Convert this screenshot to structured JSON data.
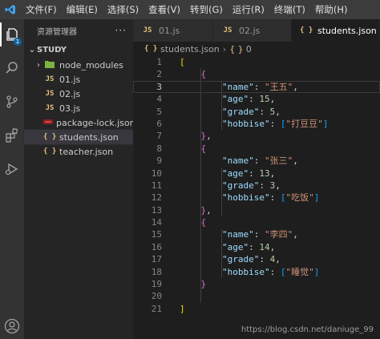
{
  "menu": [
    "文件(F)",
    "编辑(E)",
    "选择(S)",
    "查看(V)",
    "转到(G)",
    "运行(R)",
    "终端(T)",
    "帮助(H)"
  ],
  "activity": {
    "explorer_badge": "1"
  },
  "sidebar": {
    "title": "资源管理器",
    "more": "···",
    "folder": "STUDY",
    "items": [
      {
        "label": "node_modules",
        "icon": "node-folder-icon",
        "chevron": "›"
      },
      {
        "label": "01.js",
        "icon": "JS"
      },
      {
        "label": "02.js",
        "icon": "JS"
      },
      {
        "label": "03.js",
        "icon": "JS"
      },
      {
        "label": "package-lock.json",
        "icon": "lock-file-icon"
      },
      {
        "label": "students.json",
        "icon": "{ }"
      },
      {
        "label": "teacher.json",
        "icon": "{ }"
      }
    ]
  },
  "tabs": [
    {
      "label": "01.js",
      "icon": "JS"
    },
    {
      "label": "02.js",
      "icon": "JS"
    },
    {
      "label": "students.json",
      "icon": "{ }"
    }
  ],
  "breadcrumb": {
    "file_icon": "{ }",
    "file": "students.json",
    "separator": "›",
    "node_icon": "{ }",
    "node": "0"
  },
  "editor": {
    "line_numbers": [
      "1",
      "2",
      "3",
      "4",
      "5",
      "6",
      "7",
      "8",
      "9",
      "10",
      "11",
      "12",
      "13",
      "14",
      "15",
      "16",
      "17",
      "18",
      "19",
      "20",
      "21"
    ],
    "current_line": 3,
    "lines": [
      [
        {
          "t": "[",
          "c": "b1"
        }
      ],
      [
        {
          "t": "    ",
          "c": "p"
        },
        {
          "t": "{",
          "c": "b2"
        }
      ],
      [
        {
          "t": "        ",
          "c": "p"
        },
        {
          "t": "\"name\"",
          "c": "k"
        },
        {
          "t": ": ",
          "c": "p"
        },
        {
          "t": "\"王五\"",
          "c": "s"
        },
        {
          "t": ",",
          "c": "p"
        }
      ],
      [
        {
          "t": "        ",
          "c": "p"
        },
        {
          "t": "\"age\"",
          "c": "k"
        },
        {
          "t": ": ",
          "c": "p"
        },
        {
          "t": "15",
          "c": "n"
        },
        {
          "t": ",",
          "c": "p"
        }
      ],
      [
        {
          "t": "        ",
          "c": "p"
        },
        {
          "t": "\"grade\"",
          "c": "k"
        },
        {
          "t": ": ",
          "c": "p"
        },
        {
          "t": "5",
          "c": "n"
        },
        {
          "t": ",",
          "c": "p"
        }
      ],
      [
        {
          "t": "        ",
          "c": "p"
        },
        {
          "t": "\"hobbise\"",
          "c": "k"
        },
        {
          "t": ": ",
          "c": "p"
        },
        {
          "t": "[",
          "c": "b3"
        },
        {
          "t": "\"打豆豆\"",
          "c": "s"
        },
        {
          "t": "]",
          "c": "b3"
        }
      ],
      [
        {
          "t": "    ",
          "c": "p"
        },
        {
          "t": "}",
          "c": "b2"
        },
        {
          "t": ",",
          "c": "p"
        }
      ],
      [
        {
          "t": "    ",
          "c": "p"
        },
        {
          "t": "{",
          "c": "b2"
        }
      ],
      [
        {
          "t": "        ",
          "c": "p"
        },
        {
          "t": "\"name\"",
          "c": "k"
        },
        {
          "t": ": ",
          "c": "p"
        },
        {
          "t": "\"张三\"",
          "c": "s"
        },
        {
          "t": ",",
          "c": "p"
        }
      ],
      [
        {
          "t": "        ",
          "c": "p"
        },
        {
          "t": "\"age\"",
          "c": "k"
        },
        {
          "t": ": ",
          "c": "p"
        },
        {
          "t": "13",
          "c": "n"
        },
        {
          "t": ",",
          "c": "p"
        }
      ],
      [
        {
          "t": "        ",
          "c": "p"
        },
        {
          "t": "\"grade\"",
          "c": "k"
        },
        {
          "t": ": ",
          "c": "p"
        },
        {
          "t": "3",
          "c": "n"
        },
        {
          "t": ",",
          "c": "p"
        }
      ],
      [
        {
          "t": "        ",
          "c": "p"
        },
        {
          "t": "\"hobbise\"",
          "c": "k"
        },
        {
          "t": ": ",
          "c": "p"
        },
        {
          "t": "[",
          "c": "b3"
        },
        {
          "t": "\"吃饭\"",
          "c": "s"
        },
        {
          "t": "]",
          "c": "b3"
        }
      ],
      [
        {
          "t": "    ",
          "c": "p"
        },
        {
          "t": "}",
          "c": "b2"
        },
        {
          "t": ",",
          "c": "p"
        }
      ],
      [
        {
          "t": "    ",
          "c": "p"
        },
        {
          "t": "{",
          "c": "b2"
        }
      ],
      [
        {
          "t": "        ",
          "c": "p"
        },
        {
          "t": "\"name\"",
          "c": "k"
        },
        {
          "t": ": ",
          "c": "p"
        },
        {
          "t": "\"李四\"",
          "c": "s"
        },
        {
          "t": ",",
          "c": "p"
        }
      ],
      [
        {
          "t": "        ",
          "c": "p"
        },
        {
          "t": "\"age\"",
          "c": "k"
        },
        {
          "t": ": ",
          "c": "p"
        },
        {
          "t": "14",
          "c": "n"
        },
        {
          "t": ",",
          "c": "p"
        }
      ],
      [
        {
          "t": "        ",
          "c": "p"
        },
        {
          "t": "\"grade\"",
          "c": "k"
        },
        {
          "t": ": ",
          "c": "p"
        },
        {
          "t": "4",
          "c": "n"
        },
        {
          "t": ",",
          "c": "p"
        }
      ],
      [
        {
          "t": "        ",
          "c": "p"
        },
        {
          "t": "\"hobbise\"",
          "c": "k"
        },
        {
          "t": ": ",
          "c": "p"
        },
        {
          "t": "[",
          "c": "b3"
        },
        {
          "t": "\"睡觉\"",
          "c": "s"
        },
        {
          "t": "]",
          "c": "b3"
        }
      ],
      [
        {
          "t": "    ",
          "c": "p"
        },
        {
          "t": "}",
          "c": "b2"
        }
      ],
      [],
      [
        {
          "t": "]",
          "c": "b1"
        }
      ]
    ]
  },
  "watermark": "https://blog.csdn.net/daniuge_99",
  "colors": {
    "accent": "#0e639c",
    "keys": "#9cdcfe",
    "strings": "#ce9178",
    "numbers": "#b5cea8"
  }
}
